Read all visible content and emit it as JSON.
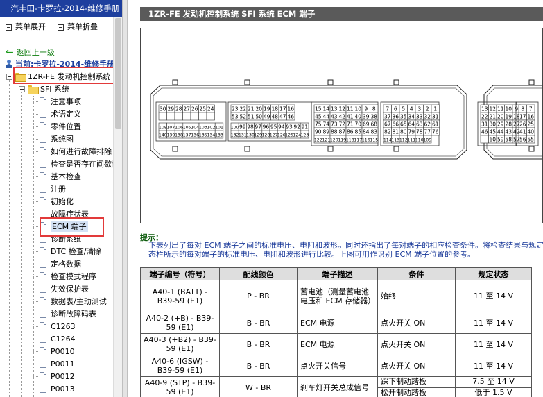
{
  "window": {
    "title": "一汽丰田-卡罗拉-2014-维修手册"
  },
  "sidebar": {
    "expand_all": "菜单展开",
    "collapse_all": "菜单折叠",
    "back": "返回上一级",
    "current": "当前:卡罗拉-2014-维修手册",
    "root": "1ZR-FE 发动机控制系统",
    "folder": "SFI 系统",
    "items": [
      "注意事项",
      "术语定义",
      "零件位置",
      "系统图",
      "如何进行故障排除",
      "检查是否存在间歇性故障",
      "基本检查",
      "注册",
      "初始化",
      "故障症状表",
      "ECM 端子",
      "诊断系统",
      "DTC 检查/清除",
      "定格数据",
      "检查模式程序",
      "失效保护表",
      "数据表/主动测试",
      "诊断故障码表",
      "C1263",
      "C1264",
      "P0010",
      "P0011",
      "P0012",
      "P0013"
    ],
    "selected_item": "ECM 端子"
  },
  "main": {
    "header": "1ZR-FE 发动机控制系统  SFI 系统  ECM 端子",
    "connector": {
      "blocks": [
        {
          "rows": [
            [
              "30",
              "29",
              "28",
              "27",
              "26",
              "25",
              "24"
            ],
            [
              "",
              "",
              "",
              "",
              "",
              "",
              ""
            ],
            [
              "108",
              "107",
              "106",
              "105",
              "104",
              "103",
              "102",
              "101"
            ],
            [
              "140",
              "139",
              "138",
              "137",
              "136",
              "135",
              "134",
              "133"
            ]
          ]
        },
        {
          "rows": [
            [
              "23",
              "22",
              "21",
              "20",
              "19",
              "18",
              "17",
              "16"
            ],
            [
              "53",
              "52",
              "51",
              "50",
              "49",
              "48",
              "47",
              "46"
            ],
            [
              "100",
              "99",
              "98",
              "97",
              "96",
              "95",
              "94",
              "93",
              "92",
              "91"
            ],
            [
              "132",
              "131",
              "130",
              "129",
              "128",
              "127",
              "126",
              "125",
              "124",
              "123"
            ]
          ]
        },
        {
          "rows": [
            [
              "15",
              "14",
              "13",
              "12",
              "11",
              "10",
              "9",
              "8"
            ],
            [
              "45",
              "44",
              "43",
              "42",
              "41",
              "40",
              "39",
              "38"
            ],
            [
              "75",
              "74",
              "73",
              "72",
              "71",
              "70",
              "69",
              "68"
            ],
            [
              "90",
              "89",
              "88",
              "87",
              "86",
              "85",
              "84",
              "83"
            ],
            [
              "122",
              "121",
              "120",
              "119",
              "118",
              "117",
              "116",
              "115"
            ]
          ]
        },
        {
          "rows": [
            [
              "7",
              "6",
              "5",
              "4",
              "3",
              "2",
              "1"
            ],
            [
              "37",
              "36",
              "35",
              "34",
              "33",
              "32",
              "31"
            ],
            [
              "67",
              "66",
              "65",
              "64",
              "63",
              "62",
              "61"
            ],
            [
              "82",
              "81",
              "80",
              "79",
              "78",
              "77",
              "76"
            ],
            [
              "114",
              "113",
              "112",
              "111",
              "110",
              "109"
            ]
          ]
        },
        {
          "rows": [
            [
              "13",
              "12",
              "11",
              "10",
              "9"
            ],
            [
              "22",
              "21",
              "20",
              "19",
              "18"
            ],
            [
              "31",
              "30",
              "29",
              "28",
              "27"
            ],
            [
              "46",
              "45",
              "44",
              "43",
              "42"
            ],
            [
              "",
              "60",
              "59",
              "58",
              "57"
            ]
          ]
        },
        {
          "rows": [
            [
              "8",
              "7"
            ],
            [
              "17",
              "16"
            ],
            [
              "26",
              "25"
            ],
            [
              "41",
              "40"
            ],
            [
              "56",
              "55"
            ]
          ]
        }
      ]
    },
    "tip": {
      "title": "提示：",
      "line1": "下表列出了每对 ECM 端子之间的标准电压、电阻和波形。同时还指出了每对端子的相应检查条件。将检查结果与规定",
      "line2": "态栏所示的每对端子的标准电压、电阻和波形进行比较。上图可用作识别 ECM 端子位置的参考。"
    },
    "table": {
      "headers": [
        "端子编号（符号）",
        "配线颜色",
        "端子描述",
        "条件",
        "规定状态"
      ],
      "rows": [
        {
          "terminal": "A40-1 (BATT) - B39-59 (E1)",
          "color": "P - BR",
          "desc": "蓄电池（测量蓄电池电压和 ECM 存储器）",
          "conditions": [
            "始终"
          ],
          "specs": [
            "11 至 14 V"
          ]
        },
        {
          "terminal": "A40-2 (+B) - B39-59 (E1)",
          "color": "B - BR",
          "desc": "ECM 电源",
          "conditions": [
            "点火开关 ON"
          ],
          "specs": [
            "11 至 14 V"
          ]
        },
        {
          "terminal": "A40-3 (+B2) - B39-59 (E1)",
          "color": "B - BR",
          "desc": "ECM 电源",
          "conditions": [
            "点火开关 ON"
          ],
          "specs": [
            "11 至 14 V"
          ]
        },
        {
          "terminal": "A40-6 (IGSW) - B39-59 (E1)",
          "color": "B - BR",
          "desc": "点火开关信号",
          "conditions": [
            "点火开关 ON"
          ],
          "specs": [
            "11 至 14 V"
          ]
        },
        {
          "terminal": "A40-9 (STP) - B39-59 (E1)",
          "color": "W - BR",
          "desc": "刹车灯开关总成信号",
          "conditions": [
            "踩下制动踏板",
            "松开制动踏板"
          ],
          "specs": [
            "7.5 至 14 V",
            "低于 1.5 V"
          ]
        }
      ]
    }
  },
  "colors": {
    "title_bar": "#1e3f9e",
    "section_header": "#5a5a5a",
    "highlight_box": "#e23a3a",
    "tip_title": "#0a5a0a",
    "tip_text": "#1a3a9a"
  }
}
